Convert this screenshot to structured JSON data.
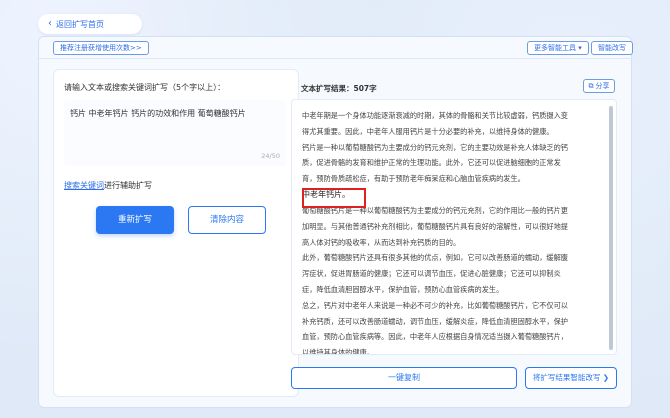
{
  "nav": {
    "back_label": "返回扩写首页"
  },
  "toolbar": {
    "tip_link": "推荐注册获增使用次数>>",
    "more_tools": "更多智能工具 ▾",
    "smart_rewrite": "智能改写"
  },
  "left": {
    "prompt_label": "请输入文本或搜索关键词扩写（5个字以上）：",
    "keyword_value": "钙片 中老年钙片 钙片的功效和作用 葡萄糖酸钙片",
    "char_count": "24/50",
    "assist_link": "搜索关键词",
    "assist_suffix": "进行辅助扩写",
    "expand_button": "重新扩写",
    "clear_button": "清除内容"
  },
  "right": {
    "result_title": "文本扩写结果：507字",
    "share_label": "分享",
    "paragraphs": [
      "中老年期是一个身体功能逐渐衰减的时期，其体的骨骼和关节比较虚弱，钙质摄入变",
      "得尤其重要。因此，中老年人服用钙片是十分必要的补充，以维持身体的健康。",
      "钙片是一种以葡萄糖酸钙为主要成分的钙元充剂，它的主要功效是补充人体缺乏的钙",
      "质，促进骨骼的发育和维护正常的生理功能。此外，它还可以促进脑细胞的正常发",
      "育，预防骨质疏松症，有助于预防老年痴呆症和心脑血管疾病的发生。"
    ],
    "subhead": "中老年钙片。",
    "paragraphs_2": [
      "葡萄糖酸钙片是一种以葡萄糖酸钙为主要成分的钙元充剂，它的作用比一般的钙片更",
      "加明显。与其他普通钙补充剂相比，葡萄糖酸钙片具有良好的溶解性，可以很好地提",
      "高人体对钙的吸收率，从而达到补充钙质的目的。",
      "此外，葡萄糖酸钙片还具有很多其他的优点，例如，它可以改善肠道的蠕动，缓解腹",
      "泻症状，促进胃肠道的健康；它还可以调节血压，促进心脏健康；它还可以抑制炎",
      "症，降低血清胆固醇水平，保护血管，预防心血管疾病的发生。",
      "总之，钙片对中老年人来说是一种必不可少的补充，比如葡萄糖酸钙片，它不仅可以",
      "补充钙质，还可以改善肠道蠕动，调节血压，缓解炎症，降低血清胆固醇水平，保护",
      "血管，预防心血管疾病等。因此，中老年人应根据自身情况适当摄入葡萄糖酸钙片，",
      "以维持其身体的健康。"
    ],
    "copy_button": "一键复制",
    "rewrite_button": "将扩写结果智能改写 ❯"
  },
  "colors": {
    "accent": "#2b78f2",
    "highlight": "#e02020"
  }
}
